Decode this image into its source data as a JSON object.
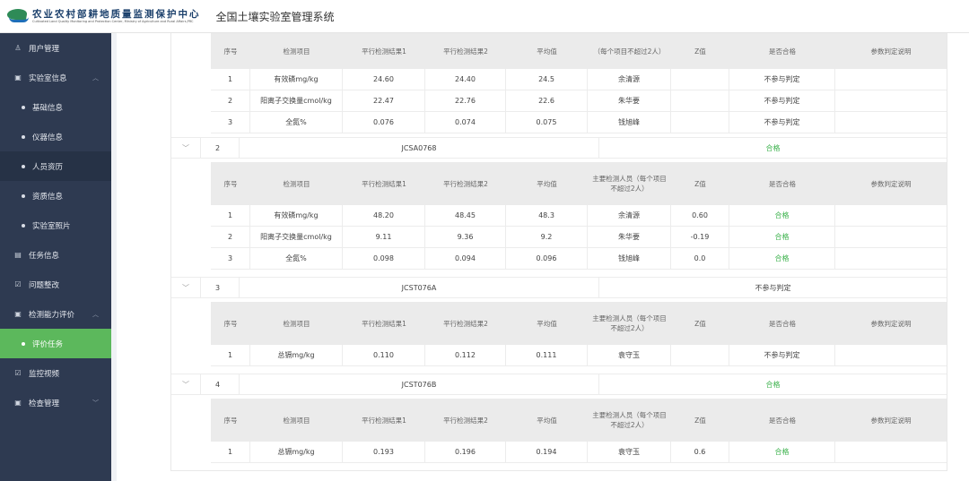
{
  "header": {
    "org_name_cn": "农业农村部耕地质量监测保护中心",
    "org_name_en": "Cultivated Land Quality Monitoring and Protection Center, Ministry of Agriculture and Rural Affairs,PRC",
    "system_title": "全国土壤实验室管理系统"
  },
  "sidebar": {
    "items": [
      {
        "label": "用户管理",
        "icon": "user-icon"
      },
      {
        "label": "实验室信息",
        "icon": "lab-icon",
        "expanded": true
      },
      {
        "label": "基础信息",
        "sub": true
      },
      {
        "label": "仪器信息",
        "sub": true
      },
      {
        "label": "人员资历",
        "sub": true,
        "highlighted": true
      },
      {
        "label": "资质信息",
        "sub": true
      },
      {
        "label": "实验室照片",
        "sub": true
      },
      {
        "label": "任务信息",
        "icon": "task-icon"
      },
      {
        "label": "问题整改",
        "icon": "check-icon"
      },
      {
        "label": "检测能力评价",
        "icon": "eval-icon",
        "expanded": true
      },
      {
        "label": "评价任务",
        "sub": true,
        "active": true
      },
      {
        "label": "监控视频",
        "icon": "video-icon"
      },
      {
        "label": "检查管理",
        "icon": "inspect-icon",
        "expanded": false
      }
    ]
  },
  "table": {
    "headers": {
      "no": "序号",
      "item": "检测项目",
      "r1": "平行检测结果1",
      "r2": "平行检测结果2",
      "avg": "平均值",
      "person": "主要检测人员（每个项目不超过2人）",
      "person_partial": "（每个项目不超过2人）",
      "z": "Z值",
      "pass": "是否合格",
      "note": "参数判定说明"
    },
    "top_rows": [
      {
        "no": "1",
        "item": "有效磷mg/kg",
        "r1": "24.60",
        "r2": "24.40",
        "avg": "24.5",
        "person": "余清源",
        "z": "",
        "pass": "不参与判定",
        "note": ""
      },
      {
        "no": "2",
        "item": "阳离子交换量cmol/kg",
        "r1": "22.47",
        "r2": "22.76",
        "avg": "22.6",
        "person": "朱华要",
        "z": "",
        "pass": "不参与判定",
        "note": ""
      },
      {
        "no": "3",
        "item": "全氮%",
        "r1": "0.076",
        "r2": "0.074",
        "avg": "0.075",
        "person": "钱旭峰",
        "z": "",
        "pass": "不参与判定",
        "note": ""
      }
    ],
    "groups": [
      {
        "no": "2",
        "code": "JCSA0768",
        "status": "合格",
        "status_ok": true,
        "rows": [
          {
            "no": "1",
            "item": "有效磷mg/kg",
            "r1": "48.20",
            "r2": "48.45",
            "avg": "48.3",
            "person": "余清源",
            "z": "0.60",
            "pass": "合格",
            "note": ""
          },
          {
            "no": "2",
            "item": "阳离子交换量cmol/kg",
            "r1": "9.11",
            "r2": "9.36",
            "avg": "9.2",
            "person": "朱华要",
            "z": "-0.19",
            "pass": "合格",
            "note": ""
          },
          {
            "no": "3",
            "item": "全氮%",
            "r1": "0.098",
            "r2": "0.094",
            "avg": "0.096",
            "person": "钱旭峰",
            "z": "0.0",
            "pass": "合格",
            "note": ""
          }
        ]
      },
      {
        "no": "3",
        "code": "JCST076A",
        "status": "不参与判定",
        "status_ok": false,
        "rows": [
          {
            "no": "1",
            "item": "总镉mg/kg",
            "r1": "0.110",
            "r2": "0.112",
            "avg": "0.111",
            "person": "袁守玉",
            "z": "",
            "pass": "不参与判定",
            "note": ""
          }
        ]
      },
      {
        "no": "4",
        "code": "JCST076B",
        "status": "合格",
        "status_ok": true,
        "rows": [
          {
            "no": "1",
            "item": "总镉mg/kg",
            "r1": "0.193",
            "r2": "0.196",
            "avg": "0.194",
            "person": "袁守玉",
            "z": "0.6",
            "pass": "合格",
            "note": ""
          }
        ]
      }
    ]
  },
  "colors": {
    "sidebar_bg": "#2e3a51",
    "active_green": "#5cb85c",
    "pass_green": "#3fb34f"
  }
}
